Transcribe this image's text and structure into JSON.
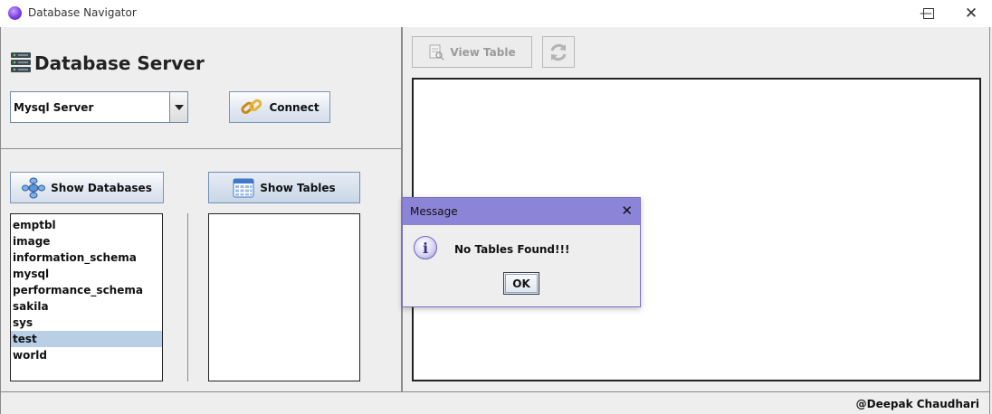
{
  "window": {
    "title": "Database Navigator",
    "minimize_icon": "minimize-icon",
    "maximize_icon": "maximize-icon",
    "close_icon": "close-icon"
  },
  "server_panel": {
    "heading": "Database Server",
    "server_select": {
      "selected": "Mysql Server"
    },
    "connect_label": "Connect"
  },
  "browse_panel": {
    "show_databases_label": "Show Databases",
    "show_tables_label": "Show Tables",
    "databases": [
      "emptbl",
      "image",
      "information_schema",
      "mysql",
      "performance_schema",
      "sakila",
      "sys",
      "test",
      "world"
    ],
    "selected_database": "test",
    "tables": []
  },
  "toolbar": {
    "view_table_label": "View Table",
    "refresh_icon": "refresh-icon"
  },
  "dialog": {
    "title": "Message",
    "message": "No Tables Found!!!",
    "ok_label": "OK",
    "icon": "info-icon"
  },
  "footer": {
    "credit": "@Deepak Chaudhari"
  },
  "colors": {
    "dialog_title_bar": "#8c84d6",
    "selection": "#b8cfe5",
    "button_border": "#7a96b8"
  }
}
